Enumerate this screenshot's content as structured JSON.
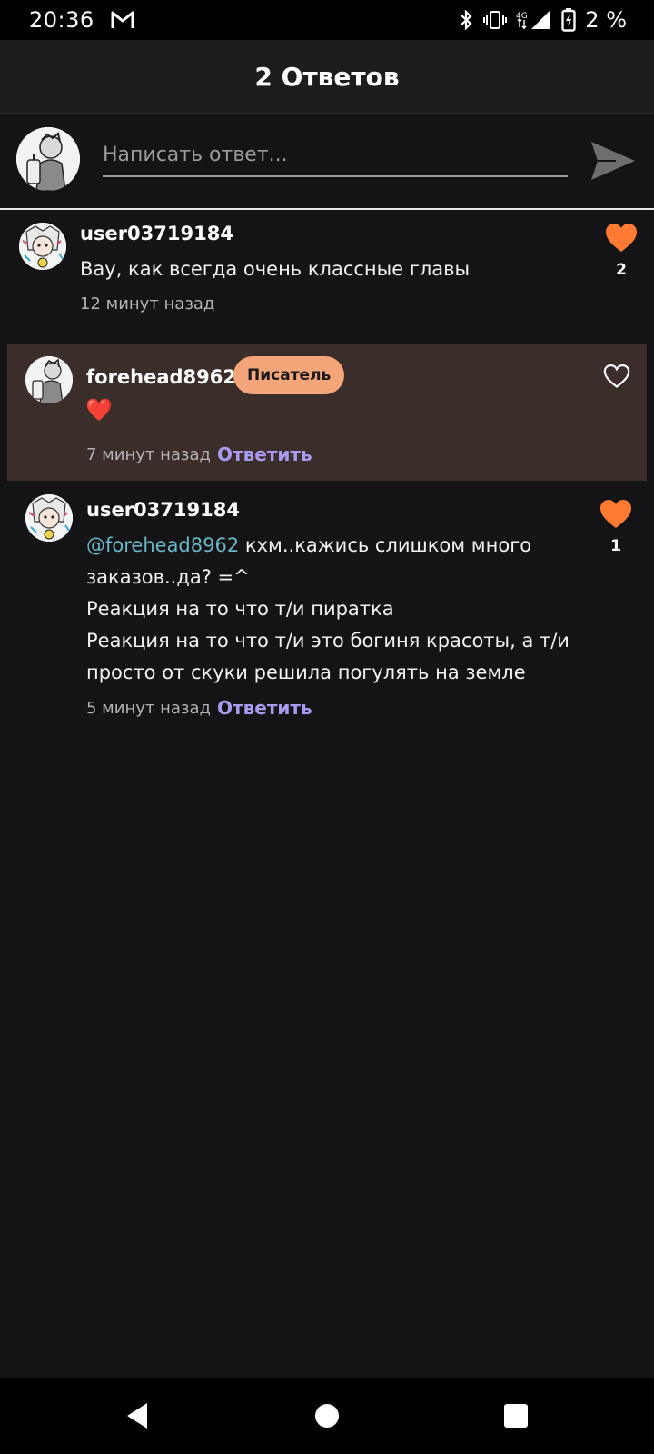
{
  "status_bar": {
    "time": "20:36",
    "network": "4G",
    "battery_percent": "2 %",
    "icons": [
      "gmail-icon",
      "bluetooth-icon",
      "vibrate-icon",
      "signal-icon",
      "battery-icon"
    ]
  },
  "header": {
    "title": "2 Ответов"
  },
  "composer": {
    "placeholder": "Написать ответ...",
    "icons": [
      "avatar",
      "send-icon"
    ]
  },
  "comments": [
    {
      "username": "user03719184",
      "text": "Вау, как всегда очень классные главы",
      "time": "12 минут назад",
      "likes": "2",
      "liked": true
    },
    {
      "username": "forehead8962",
      "badge": "Писатель",
      "text": "❤️",
      "time": "7 минут назад",
      "reply_label": "Ответить",
      "liked": false
    },
    {
      "username": "user03719184",
      "mention": "@forehead8962",
      "text_line1": " кхм..кажись слишком много",
      "text_line2": "заказов..да? =^",
      "text_line3": "Реакция на то что т/и пиратка",
      "text_line4": "Реакция на то что т/и это богиня красоты, а т/и",
      "text_line5": "просто от скуки решила погулять на земле",
      "time": "5 минут назад",
      "reply_label": "Ответить",
      "likes": "1",
      "liked": true
    }
  ],
  "colors": {
    "background": "#141316",
    "like_active": "#ff7a33",
    "reply_link": "#a99cf0",
    "mention": "#6ab8c7",
    "badge_bg": "#f5a57a",
    "highlight_bg": "#3a2d2a"
  }
}
